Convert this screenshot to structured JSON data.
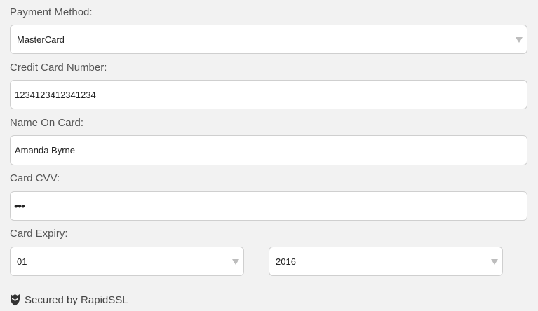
{
  "payment": {
    "label": "Payment Method:",
    "selected": "MasterCard"
  },
  "card_number": {
    "label": "Credit Card Number:",
    "value": "1234123412341234"
  },
  "name_on_card": {
    "label": "Name On Card:",
    "value": "Amanda Byrne"
  },
  "cvv": {
    "label": "Card CVV:",
    "masked_value": "•••"
  },
  "expiry": {
    "label": "Card Expiry:",
    "month": "01",
    "year": "2016"
  },
  "footer": {
    "secured_text": "Secured by RapidSSL",
    "icon": "shield-icon"
  },
  "colors": {
    "background": "#f2f2f2",
    "field_border": "#cfcfcf",
    "text": "#444444"
  }
}
